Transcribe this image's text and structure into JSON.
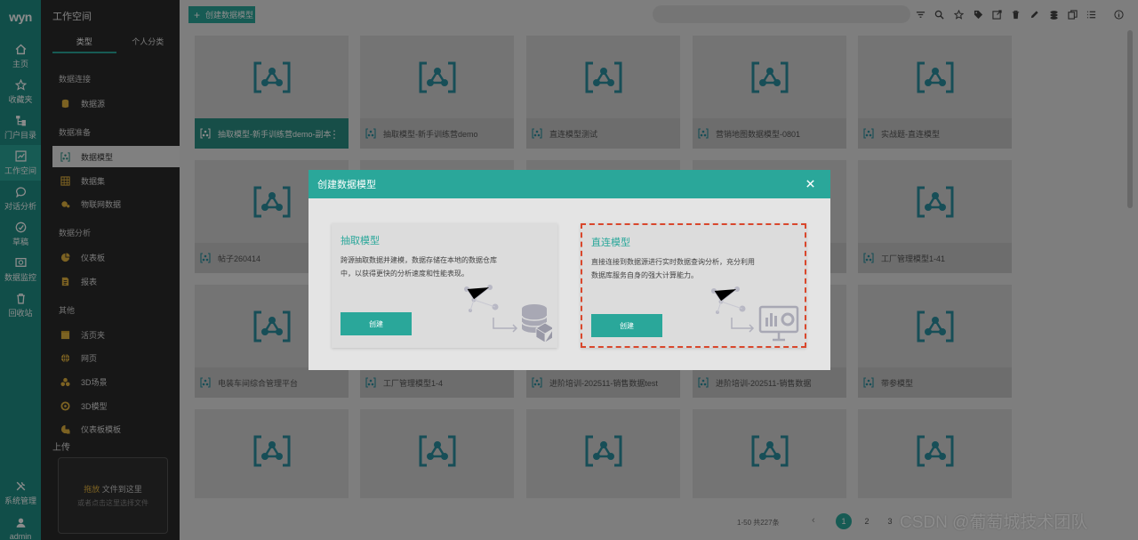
{
  "brand": {
    "logo": "wyn",
    "accent": "#2aa79a",
    "rail_bg": "#1f8f85",
    "sidebar_bg": "#2b2b2b"
  },
  "rail": {
    "items": [
      {
        "label": "主页",
        "icon": "home-icon"
      },
      {
        "label": "收藏夹",
        "icon": "star-icon"
      },
      {
        "label": "门户目录",
        "icon": "directory-icon"
      },
      {
        "label": "工作空间",
        "icon": "workspace-icon"
      },
      {
        "label": "对话分析",
        "icon": "chat-icon"
      },
      {
        "label": "草稿",
        "icon": "draft-icon"
      },
      {
        "label": "数据监控",
        "icon": "monitor-icon"
      },
      {
        "label": "回收站",
        "icon": "trash-icon"
      },
      {
        "label": "系统管理",
        "icon": "tools-icon"
      },
      {
        "label": "admin",
        "icon": "user-icon"
      }
    ]
  },
  "sidebar": {
    "title": "工作空间",
    "tabs": [
      "类型",
      "个人分类"
    ],
    "sections": {
      "conn": "数据连接",
      "prep": "数据准备",
      "analysis": "数据分析",
      "other": "其他"
    },
    "items": [
      {
        "label": "数据源",
        "icon": "database-icon"
      },
      {
        "label": "数据模型",
        "icon": "data-model-icon"
      },
      {
        "label": "数据集",
        "icon": "dataset-icon"
      },
      {
        "label": "物联网数据",
        "icon": "iot-icon"
      },
      {
        "label": "仪表板",
        "icon": "dashboard-icon"
      },
      {
        "label": "报表",
        "icon": "report-icon"
      },
      {
        "label": "活页夹",
        "icon": "binder-icon"
      },
      {
        "label": "网页",
        "icon": "globe-icon"
      },
      {
        "label": "3D场景",
        "icon": "3d-scene-icon"
      },
      {
        "label": "3D模型",
        "icon": "3d-model-icon"
      },
      {
        "label": "仪表板模板",
        "icon": "template-icon"
      }
    ],
    "upload": {
      "label": "上传",
      "drop": "拖放",
      "drop_rest": "文件到这里",
      "hint": "或者点击这里选择文件"
    }
  },
  "toolbar": {
    "create_label": "创建数据模型",
    "icons": [
      "filter-icon",
      "search-icon",
      "star-icon",
      "tag-icon",
      "open-icon",
      "delete-icon",
      "edit-icon",
      "stack-icon",
      "copy-icon",
      "list-icon",
      "info-icon"
    ]
  },
  "cards": [
    "抽取模型-新手训练营demo-副本",
    "抽取模型-新手训练营demo",
    "直连模型测试",
    "营销地图数据模型-0801",
    "实战题-直连模型",
    "帖子260414",
    "",
    "",
    "",
    "工厂管理模型1-41",
    "电装车间综合管理平台",
    "工厂管理模型1-4",
    "进阶培训-202511-销售数据test",
    "进阶培训-202511-销售数据",
    "带参模型",
    "",
    "",
    "",
    "",
    ""
  ],
  "pager": {
    "info": "1-50 共227条",
    "pages": [
      "1",
      "2",
      "3"
    ]
  },
  "watermark": "CSDN @葡萄城技术团队",
  "modal": {
    "title": "创建数据模型",
    "options": [
      {
        "title": "抽取模型",
        "desc": "跨源抽取数据并建模，数据存储在本地的数据仓库中，以获得更快的分析速度和性能表现。",
        "button": "创建"
      },
      {
        "title": "直连模型",
        "desc": "直接连接到数据源进行实时数据查询分析，充分利用数据库服务自身的强大计算能力。",
        "button": "创建"
      }
    ]
  }
}
